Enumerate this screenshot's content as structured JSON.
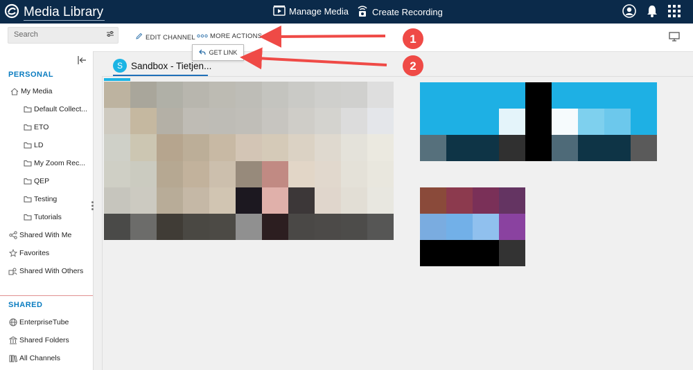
{
  "app": {
    "title": "Media Library"
  },
  "topnav": {
    "manage_media": "Manage Media",
    "create_recording": "Create Recording"
  },
  "toolbar": {
    "search_placeholder": "Search",
    "edit_channel": "EDIT CHANNEL",
    "more_actions": "MORE ACTIONS",
    "get_link": "GET LINK"
  },
  "sidebar": {
    "personal_title": "PERSONAL",
    "my_media": "My Media",
    "folders": [
      "Default Collect...",
      "ETO",
      "LD",
      "My Zoom Rec...",
      "QEP",
      "Testing",
      "Tutorials"
    ],
    "shared_with_me": "Shared With Me",
    "favorites": "Favorites",
    "shared_with_others": "Shared With Others",
    "shared_title": "SHARED",
    "enterprise_tube": "EnterpriseTube",
    "shared_folders": "Shared Folders",
    "all_channels": "All Channels"
  },
  "channel": {
    "avatar_letter": "S",
    "title": "Sandbox - Tietjen..."
  },
  "annotations": {
    "callout_1": "1",
    "callout_2": "2"
  },
  "colors": {
    "topbar": "#0b2a4a",
    "accent": "#0a7cc0",
    "callout": "#ef4a46"
  },
  "thumbnails": {
    "large": [
      [
        "#bdb3a0",
        "#a9a69b",
        "#b0b0a7",
        "#b8b6ae",
        "#bdbbb3",
        "#bebdb7",
        "#c4c4bf",
        "#cacac6",
        "#cfcfcc",
        "#d0d0ce",
        "#dedede"
      ],
      [
        "#cecac0",
        "#c5b8a0",
        "#b4b0a6",
        "#bfbcb5",
        "#bebcb6",
        "#c0beb8",
        "#c7c5c0",
        "#cfcdc8",
        "#d4d3cf",
        "#dcdcdc",
        "#e4e6ea"
      ],
      [
        "#cfd0c8",
        "#ccc6b2",
        "#b6a58e",
        "#bcae98",
        "#c8b9a4",
        "#d3c5b5",
        "#d5cab8",
        "#dbd2c4",
        "#dfd9cf",
        "#e4e2da",
        "#ebe9e0"
      ],
      [
        "#cfcfc5",
        "#cbcbc0",
        "#b6a892",
        "#c2b29c",
        "#ccbfad",
        "#978a7b",
        "#c18a83",
        "#e2d6c7",
        "#e1d8cd",
        "#e4e1d8",
        "#e9e7de"
      ],
      [
        "#c6c5bd",
        "#cccac1",
        "#b8ac98",
        "#c5b8a6",
        "#d1c5b2",
        "#1c1820",
        "#e0b0aa",
        "#3c3738",
        "#e0d6cc",
        "#e2ded5",
        "#e8e7e0"
      ],
      [
        "#4a4a48",
        "#6c6c6a",
        "#403c36",
        "#4a4843",
        "#4c4a45",
        "#909090",
        "#2c1e20",
        "#4a4846",
        "#4c4a48",
        "#4d4c4a",
        "#565655"
      ]
    ],
    "top_right": [
      [
        "#1eb0e4",
        "#1eb0e4",
        "#1eb0e4",
        "#1eb0e4",
        "#000000",
        "#1eb0e4",
        "#1eb0e4",
        "#1eb0e4",
        "#1eb0e4"
      ],
      [
        "#1eb0e4",
        "#1eb0e4",
        "#1eb0e4",
        "#e4f4fa",
        "#000000",
        "#f6fbfd",
        "#7ed0ee",
        "#6cc8ec",
        "#1eb0e4"
      ],
      [
        "#56707c",
        "#0e3446",
        "#0e3446",
        "#303030",
        "#000000",
        "#4e6a78",
        "#0e3446",
        "#0e3446",
        "#5a5a5a"
      ]
    ],
    "bottom_right": [
      [
        "#8a4a3a",
        "#8c3a4e",
        "#7a3058",
        "#643462"
      ],
      [
        "#7aace0",
        "#72b0e8",
        "#90c0ee",
        "#8a42a0"
      ],
      [
        "#000000",
        "#000000",
        "#000000",
        "#333333"
      ]
    ]
  }
}
